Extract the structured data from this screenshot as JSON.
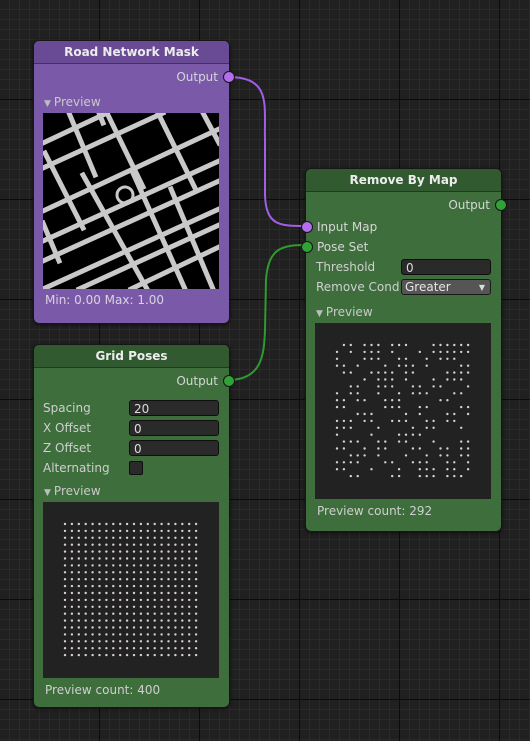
{
  "nodes": {
    "road": {
      "title": "Road Network Mask",
      "output_label": "Output",
      "preview_label": "Preview",
      "stats": "Min: 0.00 Max: 1.00"
    },
    "grid": {
      "title": "Grid Poses",
      "output_label": "Output",
      "fields": [
        {
          "label": "Spacing",
          "value": "20"
        },
        {
          "label": "X Offset",
          "value": "0"
        },
        {
          "label": "Z Offset",
          "value": "0"
        }
      ],
      "alternating_label": "Alternating",
      "alternating_checked": false,
      "preview_label": "Preview",
      "preview_count": "Preview count: 400"
    },
    "remove": {
      "title": "Remove By Map",
      "output_label": "Output",
      "input_map_label": "Input Map",
      "pose_set_label": "Pose Set",
      "threshold_label": "Threshold",
      "threshold_value": "0",
      "remove_condition_label": "Remove Condi",
      "remove_condition_value": "Greater",
      "preview_label": "Preview",
      "preview_count": "Preview count: 292"
    }
  },
  "colors": {
    "purple_node": "#7a5aa8",
    "green_node": "#3e6e3c",
    "purple_wire": "#a35ee8",
    "green_wire": "#2f9a31"
  },
  "icons": {
    "port": "circle",
    "foldout": "triangle-down"
  }
}
